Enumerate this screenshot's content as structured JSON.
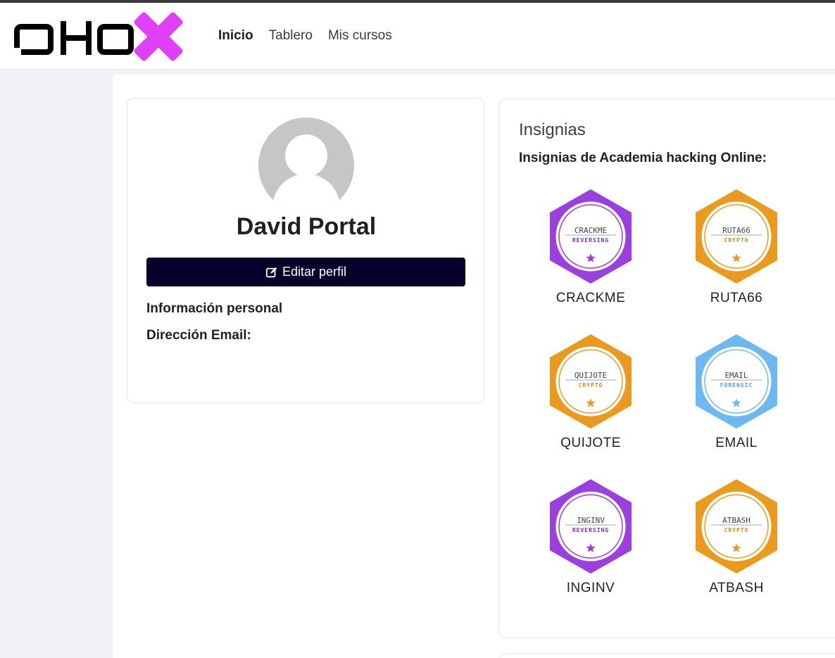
{
  "brand": {
    "name": "AHO",
    "accent": "#e040fb",
    "dark": "#000000"
  },
  "nav": {
    "items": [
      {
        "label": "Inicio",
        "active": true
      },
      {
        "label": "Tablero",
        "active": false
      },
      {
        "label": "Mis cursos",
        "active": false
      }
    ]
  },
  "profile": {
    "name": "David Portal",
    "edit_button": "Editar perfil",
    "personal_info_heading": "Información personal",
    "email_label": "Dirección Email:"
  },
  "badges": {
    "heading": "Insignias",
    "subheading": "Insignias de Academia hacking Online:",
    "items": [
      {
        "label": "CRACKME",
        "title": "CRACKME",
        "category": "REVERSING",
        "color": "#9b3fe0",
        "textcolor": "#7a30c4"
      },
      {
        "label": "RUTA66",
        "title": "RUTA66",
        "category": "CRYPTO",
        "color": "#eb9a1e",
        "textcolor": "#d88a10"
      },
      {
        "label": "QUIJOTE",
        "title": "QUIJOTE",
        "category": "CRYPTO",
        "color": "#eb9a1e",
        "textcolor": "#d88a10"
      },
      {
        "label": "EMAIL",
        "title": "EMAIL",
        "category": "FORENSIC",
        "color": "#6cb9f2",
        "textcolor": "#4aa3e6"
      },
      {
        "label": "INGINV",
        "title": "INGINV",
        "category": "REVERSING",
        "color": "#9b3fe0",
        "textcolor": "#7a30c4"
      },
      {
        "label": "ATBASH",
        "title": "ATBASH",
        "category": "CRYPTO",
        "color": "#eb9a1e",
        "textcolor": "#d88a10"
      }
    ]
  }
}
